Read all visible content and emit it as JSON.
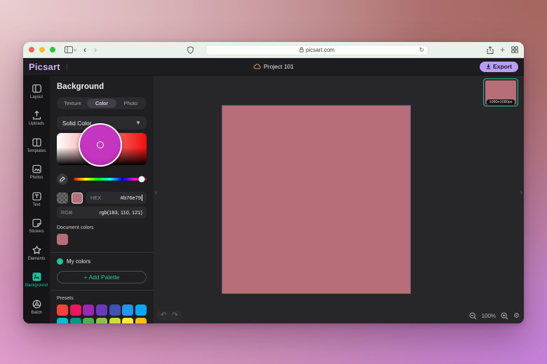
{
  "browser": {
    "url": "picsart.com",
    "traffic": {
      "close": "#ff5f57",
      "minimize": "#febc2e",
      "zoom": "#29c73f"
    }
  },
  "header": {
    "logo": "Picsart",
    "divider": "|",
    "project_name": "Project 101",
    "export_label": "Export"
  },
  "sidebar": {
    "active_color": "#17c79b",
    "items": [
      {
        "label": "Layout"
      },
      {
        "label": "Uploads"
      },
      {
        "label": "Templates"
      },
      {
        "label": "Photos"
      },
      {
        "label": "Text"
      },
      {
        "label": "Stickers"
      },
      {
        "label": "Elements"
      },
      {
        "label": "Background",
        "active": true
      },
      {
        "label": "Batch"
      }
    ]
  },
  "panel": {
    "title": "Background",
    "tabs": [
      {
        "label": "Texture"
      },
      {
        "label": "Color",
        "active": true
      },
      {
        "label": "Photo"
      }
    ],
    "fill_type_value": "Solid Color",
    "hex_label": "HEX",
    "hex_value": "#b76e79",
    "rgb_label": "RGB",
    "rgb_value": "rgb(183, 110, 121)",
    "document_colors_label": "Document colors",
    "document_colors": [
      "#b76e79"
    ],
    "my_colors_label": "My colors",
    "add_palette_label": "+ Add Palette",
    "presets_label": "Presets",
    "preset_colors": [
      "#f4433a",
      "#e8185d",
      "#9c27b0",
      "#673ab7",
      "#3f51b5",
      "#2196f3",
      "#03a9f4",
      "#00bcd4",
      "#009688",
      "#4caf50",
      "#8bc34a",
      "#cddc39",
      "#ffeb3b",
      "#ffc107",
      "#ff9800",
      "#ff5722",
      "#795548",
      "#9e9e9e",
      "#607d8b"
    ]
  },
  "canvas": {
    "color": "#b76e79",
    "zoom_value": "100%"
  },
  "thumbnail": {
    "size_label": "1080x1080px",
    "color": "#b76e79"
  }
}
